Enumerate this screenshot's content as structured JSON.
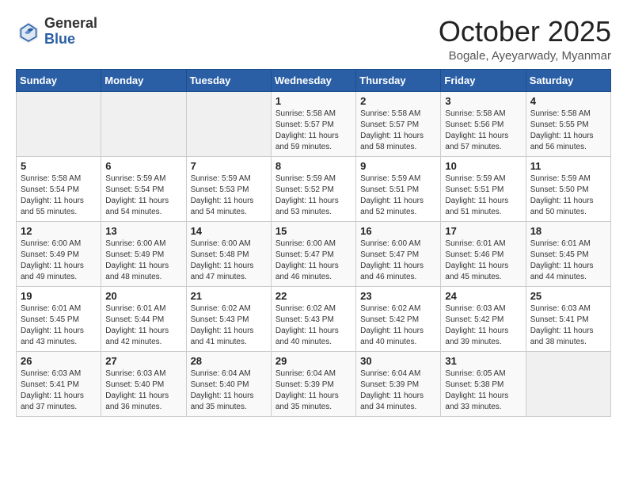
{
  "logo": {
    "general": "General",
    "blue": "Blue"
  },
  "header": {
    "month": "October 2025",
    "location": "Bogale, Ayeyarwady, Myanmar"
  },
  "weekdays": [
    "Sunday",
    "Monday",
    "Tuesday",
    "Wednesday",
    "Thursday",
    "Friday",
    "Saturday"
  ],
  "weeks": [
    [
      {
        "day": "",
        "info": ""
      },
      {
        "day": "",
        "info": ""
      },
      {
        "day": "",
        "info": ""
      },
      {
        "day": "1",
        "info": "Sunrise: 5:58 AM\nSunset: 5:57 PM\nDaylight: 11 hours\nand 59 minutes."
      },
      {
        "day": "2",
        "info": "Sunrise: 5:58 AM\nSunset: 5:57 PM\nDaylight: 11 hours\nand 58 minutes."
      },
      {
        "day": "3",
        "info": "Sunrise: 5:58 AM\nSunset: 5:56 PM\nDaylight: 11 hours\nand 57 minutes."
      },
      {
        "day": "4",
        "info": "Sunrise: 5:58 AM\nSunset: 5:55 PM\nDaylight: 11 hours\nand 56 minutes."
      }
    ],
    [
      {
        "day": "5",
        "info": "Sunrise: 5:58 AM\nSunset: 5:54 PM\nDaylight: 11 hours\nand 55 minutes."
      },
      {
        "day": "6",
        "info": "Sunrise: 5:59 AM\nSunset: 5:54 PM\nDaylight: 11 hours\nand 54 minutes."
      },
      {
        "day": "7",
        "info": "Sunrise: 5:59 AM\nSunset: 5:53 PM\nDaylight: 11 hours\nand 54 minutes."
      },
      {
        "day": "8",
        "info": "Sunrise: 5:59 AM\nSunset: 5:52 PM\nDaylight: 11 hours\nand 53 minutes."
      },
      {
        "day": "9",
        "info": "Sunrise: 5:59 AM\nSunset: 5:51 PM\nDaylight: 11 hours\nand 52 minutes."
      },
      {
        "day": "10",
        "info": "Sunrise: 5:59 AM\nSunset: 5:51 PM\nDaylight: 11 hours\nand 51 minutes."
      },
      {
        "day": "11",
        "info": "Sunrise: 5:59 AM\nSunset: 5:50 PM\nDaylight: 11 hours\nand 50 minutes."
      }
    ],
    [
      {
        "day": "12",
        "info": "Sunrise: 6:00 AM\nSunset: 5:49 PM\nDaylight: 11 hours\nand 49 minutes."
      },
      {
        "day": "13",
        "info": "Sunrise: 6:00 AM\nSunset: 5:49 PM\nDaylight: 11 hours\nand 48 minutes."
      },
      {
        "day": "14",
        "info": "Sunrise: 6:00 AM\nSunset: 5:48 PM\nDaylight: 11 hours\nand 47 minutes."
      },
      {
        "day": "15",
        "info": "Sunrise: 6:00 AM\nSunset: 5:47 PM\nDaylight: 11 hours\nand 46 minutes."
      },
      {
        "day": "16",
        "info": "Sunrise: 6:00 AM\nSunset: 5:47 PM\nDaylight: 11 hours\nand 46 minutes."
      },
      {
        "day": "17",
        "info": "Sunrise: 6:01 AM\nSunset: 5:46 PM\nDaylight: 11 hours\nand 45 minutes."
      },
      {
        "day": "18",
        "info": "Sunrise: 6:01 AM\nSunset: 5:45 PM\nDaylight: 11 hours\nand 44 minutes."
      }
    ],
    [
      {
        "day": "19",
        "info": "Sunrise: 6:01 AM\nSunset: 5:45 PM\nDaylight: 11 hours\nand 43 minutes."
      },
      {
        "day": "20",
        "info": "Sunrise: 6:01 AM\nSunset: 5:44 PM\nDaylight: 11 hours\nand 42 minutes."
      },
      {
        "day": "21",
        "info": "Sunrise: 6:02 AM\nSunset: 5:43 PM\nDaylight: 11 hours\nand 41 minutes."
      },
      {
        "day": "22",
        "info": "Sunrise: 6:02 AM\nSunset: 5:43 PM\nDaylight: 11 hours\nand 40 minutes."
      },
      {
        "day": "23",
        "info": "Sunrise: 6:02 AM\nSunset: 5:42 PM\nDaylight: 11 hours\nand 40 minutes."
      },
      {
        "day": "24",
        "info": "Sunrise: 6:03 AM\nSunset: 5:42 PM\nDaylight: 11 hours\nand 39 minutes."
      },
      {
        "day": "25",
        "info": "Sunrise: 6:03 AM\nSunset: 5:41 PM\nDaylight: 11 hours\nand 38 minutes."
      }
    ],
    [
      {
        "day": "26",
        "info": "Sunrise: 6:03 AM\nSunset: 5:41 PM\nDaylight: 11 hours\nand 37 minutes."
      },
      {
        "day": "27",
        "info": "Sunrise: 6:03 AM\nSunset: 5:40 PM\nDaylight: 11 hours\nand 36 minutes."
      },
      {
        "day": "28",
        "info": "Sunrise: 6:04 AM\nSunset: 5:40 PM\nDaylight: 11 hours\nand 35 minutes."
      },
      {
        "day": "29",
        "info": "Sunrise: 6:04 AM\nSunset: 5:39 PM\nDaylight: 11 hours\nand 35 minutes."
      },
      {
        "day": "30",
        "info": "Sunrise: 6:04 AM\nSunset: 5:39 PM\nDaylight: 11 hours\nand 34 minutes."
      },
      {
        "day": "31",
        "info": "Sunrise: 6:05 AM\nSunset: 5:38 PM\nDaylight: 11 hours\nand 33 minutes."
      },
      {
        "day": "",
        "info": ""
      }
    ]
  ]
}
